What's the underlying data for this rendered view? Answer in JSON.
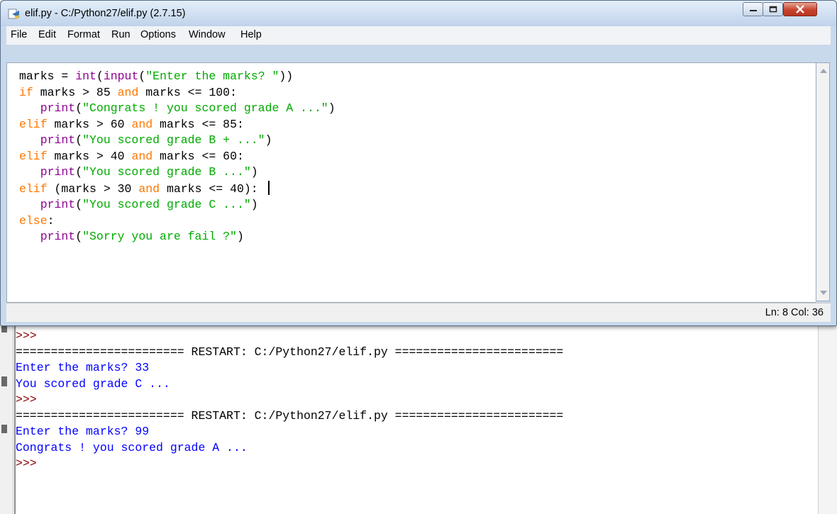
{
  "editor": {
    "title": "elif.py - C:/Python27/elif.py (2.7.15)",
    "menu": [
      "File",
      "Edit",
      "Format",
      "Run",
      "Options",
      "Window",
      "Help"
    ],
    "code_lines": [
      [
        {
          "t": "marks = ",
          "c": ""
        },
        {
          "t": "int",
          "c": "bi"
        },
        {
          "t": "(",
          "c": ""
        },
        {
          "t": "input",
          "c": "bi"
        },
        {
          "t": "(",
          "c": ""
        },
        {
          "t": "\"Enter the marks? \"",
          "c": "str"
        },
        {
          "t": "))",
          "c": ""
        }
      ],
      [
        {
          "t": "if",
          "c": "kw"
        },
        {
          "t": " marks > 85 ",
          "c": ""
        },
        {
          "t": "and",
          "c": "kw"
        },
        {
          "t": " marks <= 100:",
          "c": ""
        }
      ],
      [
        {
          "t": "   print",
          "c": "bi"
        },
        {
          "t": "(",
          "c": ""
        },
        {
          "t": "\"Congrats ! you scored grade A ...\"",
          "c": "str"
        },
        {
          "t": ")",
          "c": ""
        }
      ],
      [
        {
          "t": "elif",
          "c": "kw"
        },
        {
          "t": " marks > 60 ",
          "c": ""
        },
        {
          "t": "and",
          "c": "kw"
        },
        {
          "t": " marks <= 85:",
          "c": ""
        }
      ],
      [
        {
          "t": "   print",
          "c": "bi"
        },
        {
          "t": "(",
          "c": ""
        },
        {
          "t": "\"You scored grade B + ...\"",
          "c": "str"
        },
        {
          "t": ")",
          "c": ""
        }
      ],
      [
        {
          "t": "elif",
          "c": "kw"
        },
        {
          "t": " marks > 40 ",
          "c": ""
        },
        {
          "t": "and",
          "c": "kw"
        },
        {
          "t": " marks <= 60:",
          "c": ""
        }
      ],
      [
        {
          "t": "   print",
          "c": "bi"
        },
        {
          "t": "(",
          "c": ""
        },
        {
          "t": "\"You scored grade B ...\"",
          "c": "str"
        },
        {
          "t": ")",
          "c": ""
        }
      ],
      [
        {
          "t": "elif",
          "c": "kw"
        },
        {
          "t": " (marks > 30 ",
          "c": ""
        },
        {
          "t": "and",
          "c": "kw"
        },
        {
          "t": " marks <= 40):",
          "c": ""
        }
      ],
      [
        {
          "t": "   print",
          "c": "bi"
        },
        {
          "t": "(",
          "c": ""
        },
        {
          "t": "\"You scored grade C ...\"",
          "c": "str"
        },
        {
          "t": ")",
          "c": ""
        }
      ],
      [
        {
          "t": "else",
          "c": "kw"
        },
        {
          "t": ":",
          "c": ""
        }
      ],
      [
        {
          "t": "   print",
          "c": "bi"
        },
        {
          "t": "(",
          "c": ""
        },
        {
          "t": "\"Sorry you are fail ?\"",
          "c": "str"
        },
        {
          "t": ")",
          "c": ""
        }
      ]
    ],
    "cursor_line": 7,
    "status": "Ln: 8  Col: 36"
  },
  "shell": {
    "lines": [
      {
        "t": ">>>",
        "c": "sh-prompt"
      },
      {
        "t": "======================== RESTART: C:/Python27/elif.py ========================",
        "c": "sh-restart"
      },
      {
        "t": "Enter the marks? 33",
        "c": "sh-out"
      },
      {
        "t": "You scored grade C ...",
        "c": "sh-out"
      },
      {
        "t": ">>>",
        "c": "sh-prompt"
      },
      {
        "t": "======================== RESTART: C:/Python27/elif.py ========================",
        "c": "sh-restart"
      },
      {
        "t": "Enter the marks? 99",
        "c": "sh-out"
      },
      {
        "t": "Congrats ! you scored grade A ...",
        "c": "sh-out"
      },
      {
        "t": ">>>",
        "c": "sh-prompt"
      }
    ]
  },
  "colors": {
    "keyword": "#ff7700",
    "builtin": "#900090",
    "string": "#00aa00",
    "shell_output": "#0000ff",
    "prompt": "#8b0000"
  }
}
